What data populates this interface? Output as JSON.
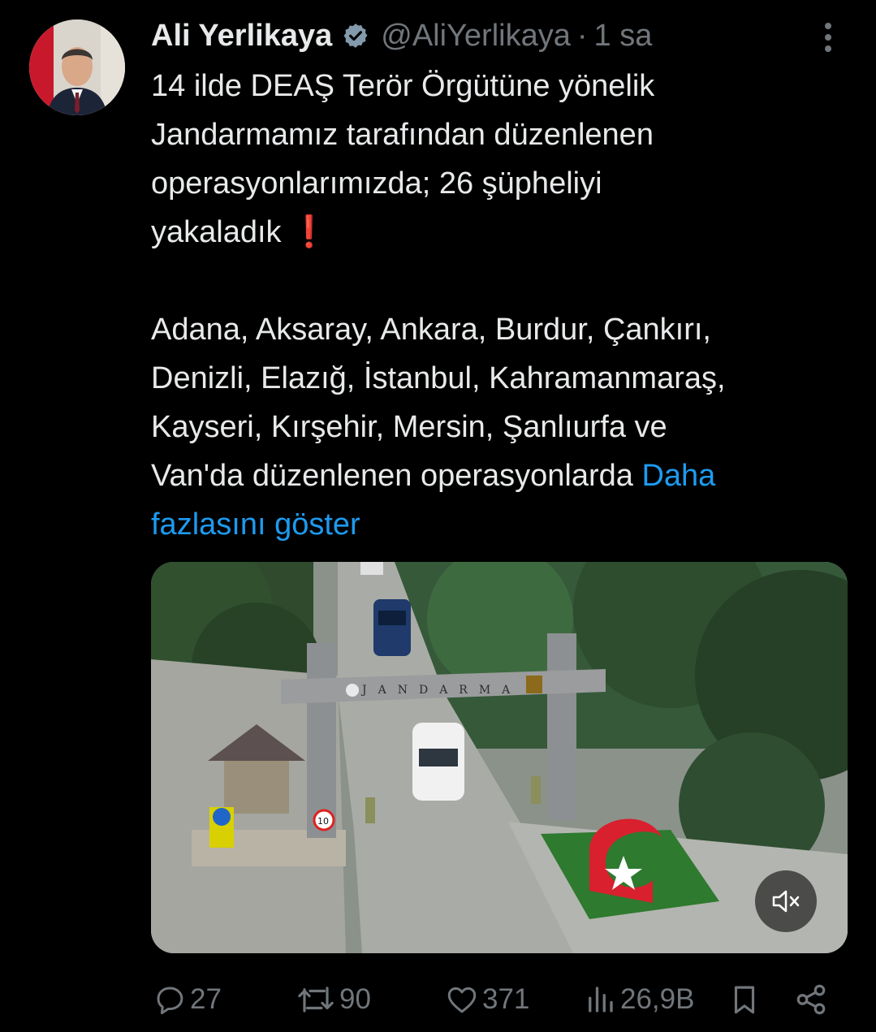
{
  "tweet": {
    "author": {
      "display_name": "Ali Yerlikaya",
      "handle": "@AliYerlikaya",
      "verified": true
    },
    "separator": "·",
    "time": "1 sa",
    "text_lines_1": [
      "14 ilde DEAŞ Terör Örgütüne yönelik",
      "Jandarmamız tarafından düzenlenen",
      "operasyonlarımızda; 26 şüpheliyi",
      "yakaladık ❗"
    ],
    "text_lines_2": [
      "Adana, Aksaray, Ankara, Burdur, Çankırı,",
      "Denizli, Elazığ, İstanbul, Kahramanmaraş,",
      "Kayseri, Kırşehir, Mersin, Şanlıurfa ve"
    ],
    "last_line_text": "Van'da düzenlenen operasyonlarda ",
    "show_more_part1": "Daha",
    "show_more_part2": "fazlasını göster",
    "media": {
      "type": "video",
      "gate_sign": "JANDARMA",
      "speed_sign": "10",
      "muted": true,
      "mute_icon": "speaker-muted-icon"
    },
    "actions": {
      "replies": "27",
      "reposts": "90",
      "likes": "371",
      "views": "26,9B"
    },
    "colors": {
      "background": "#000000",
      "text": "#e7e9ea",
      "secondary": "#71767b",
      "link": "#1d9bf0",
      "exclamation": "#f4212e"
    }
  }
}
